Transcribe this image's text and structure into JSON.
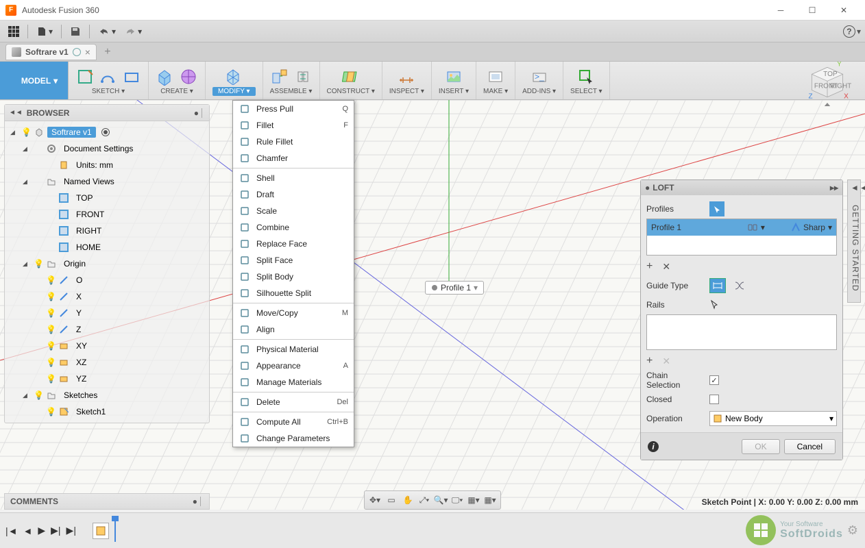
{
  "app": {
    "title": "Autodesk Fusion 360"
  },
  "document": {
    "name": "Softrare v1"
  },
  "mode": "MODEL",
  "ribbon": [
    {
      "label": "SKETCH"
    },
    {
      "label": "CREATE"
    },
    {
      "label": "MODIFY",
      "active": true
    },
    {
      "label": "ASSEMBLE"
    },
    {
      "label": "CONSTRUCT"
    },
    {
      "label": "INSPECT"
    },
    {
      "label": "INSERT"
    },
    {
      "label": "MAKE"
    },
    {
      "label": "ADD-INS"
    },
    {
      "label": "SELECT"
    }
  ],
  "browser": {
    "title": "BROWSER",
    "root": "Softrare v1",
    "docset": "Document Settings",
    "units": "Units: mm",
    "named": "Named Views",
    "views": [
      "TOP",
      "FRONT",
      "RIGHT",
      "HOME"
    ],
    "origin": "Origin",
    "axes": [
      "O",
      "X",
      "Y",
      "Z",
      "XY",
      "XZ",
      "YZ"
    ],
    "sketches": "Sketches",
    "sketch1": "Sketch1"
  },
  "menu": [
    {
      "label": "Press Pull",
      "sc": "Q"
    },
    {
      "label": "Fillet",
      "sc": "F"
    },
    {
      "label": "Rule Fillet"
    },
    {
      "label": "Chamfer"
    },
    {
      "sep": true
    },
    {
      "label": "Shell"
    },
    {
      "label": "Draft"
    },
    {
      "label": "Scale"
    },
    {
      "label": "Combine"
    },
    {
      "label": "Replace Face"
    },
    {
      "label": "Split Face"
    },
    {
      "label": "Split Body"
    },
    {
      "label": "Silhouette Split"
    },
    {
      "sep": true
    },
    {
      "label": "Move/Copy",
      "sc": "M"
    },
    {
      "label": "Align"
    },
    {
      "sep": true
    },
    {
      "label": "Physical Material"
    },
    {
      "label": "Appearance",
      "sc": "A"
    },
    {
      "label": "Manage Materials"
    },
    {
      "sep": true
    },
    {
      "label": "Delete",
      "sc": "Del"
    },
    {
      "sep": true
    },
    {
      "label": "Compute All",
      "sc": "Ctrl+B"
    },
    {
      "label": "Change Parameters"
    }
  ],
  "profile_tag": "Profile 1",
  "loft": {
    "title": "LOFT",
    "profiles": "Profiles",
    "profile1": "Profile 1",
    "sharp": "Sharp",
    "guide": "Guide Type",
    "rails": "Rails",
    "chain": "Chain Selection",
    "closed": "Closed",
    "operation": "Operation",
    "newbody": "New Body",
    "ok": "OK",
    "cancel": "Cancel"
  },
  "side": "GETTING STARTED",
  "comments": "COMMENTS",
  "status": "Sketch Point | X: 0.00 Y: 0.00 Z: 0.00 mm",
  "watermark": {
    "line1": "Your Software",
    "line2": "SoftDroids"
  }
}
